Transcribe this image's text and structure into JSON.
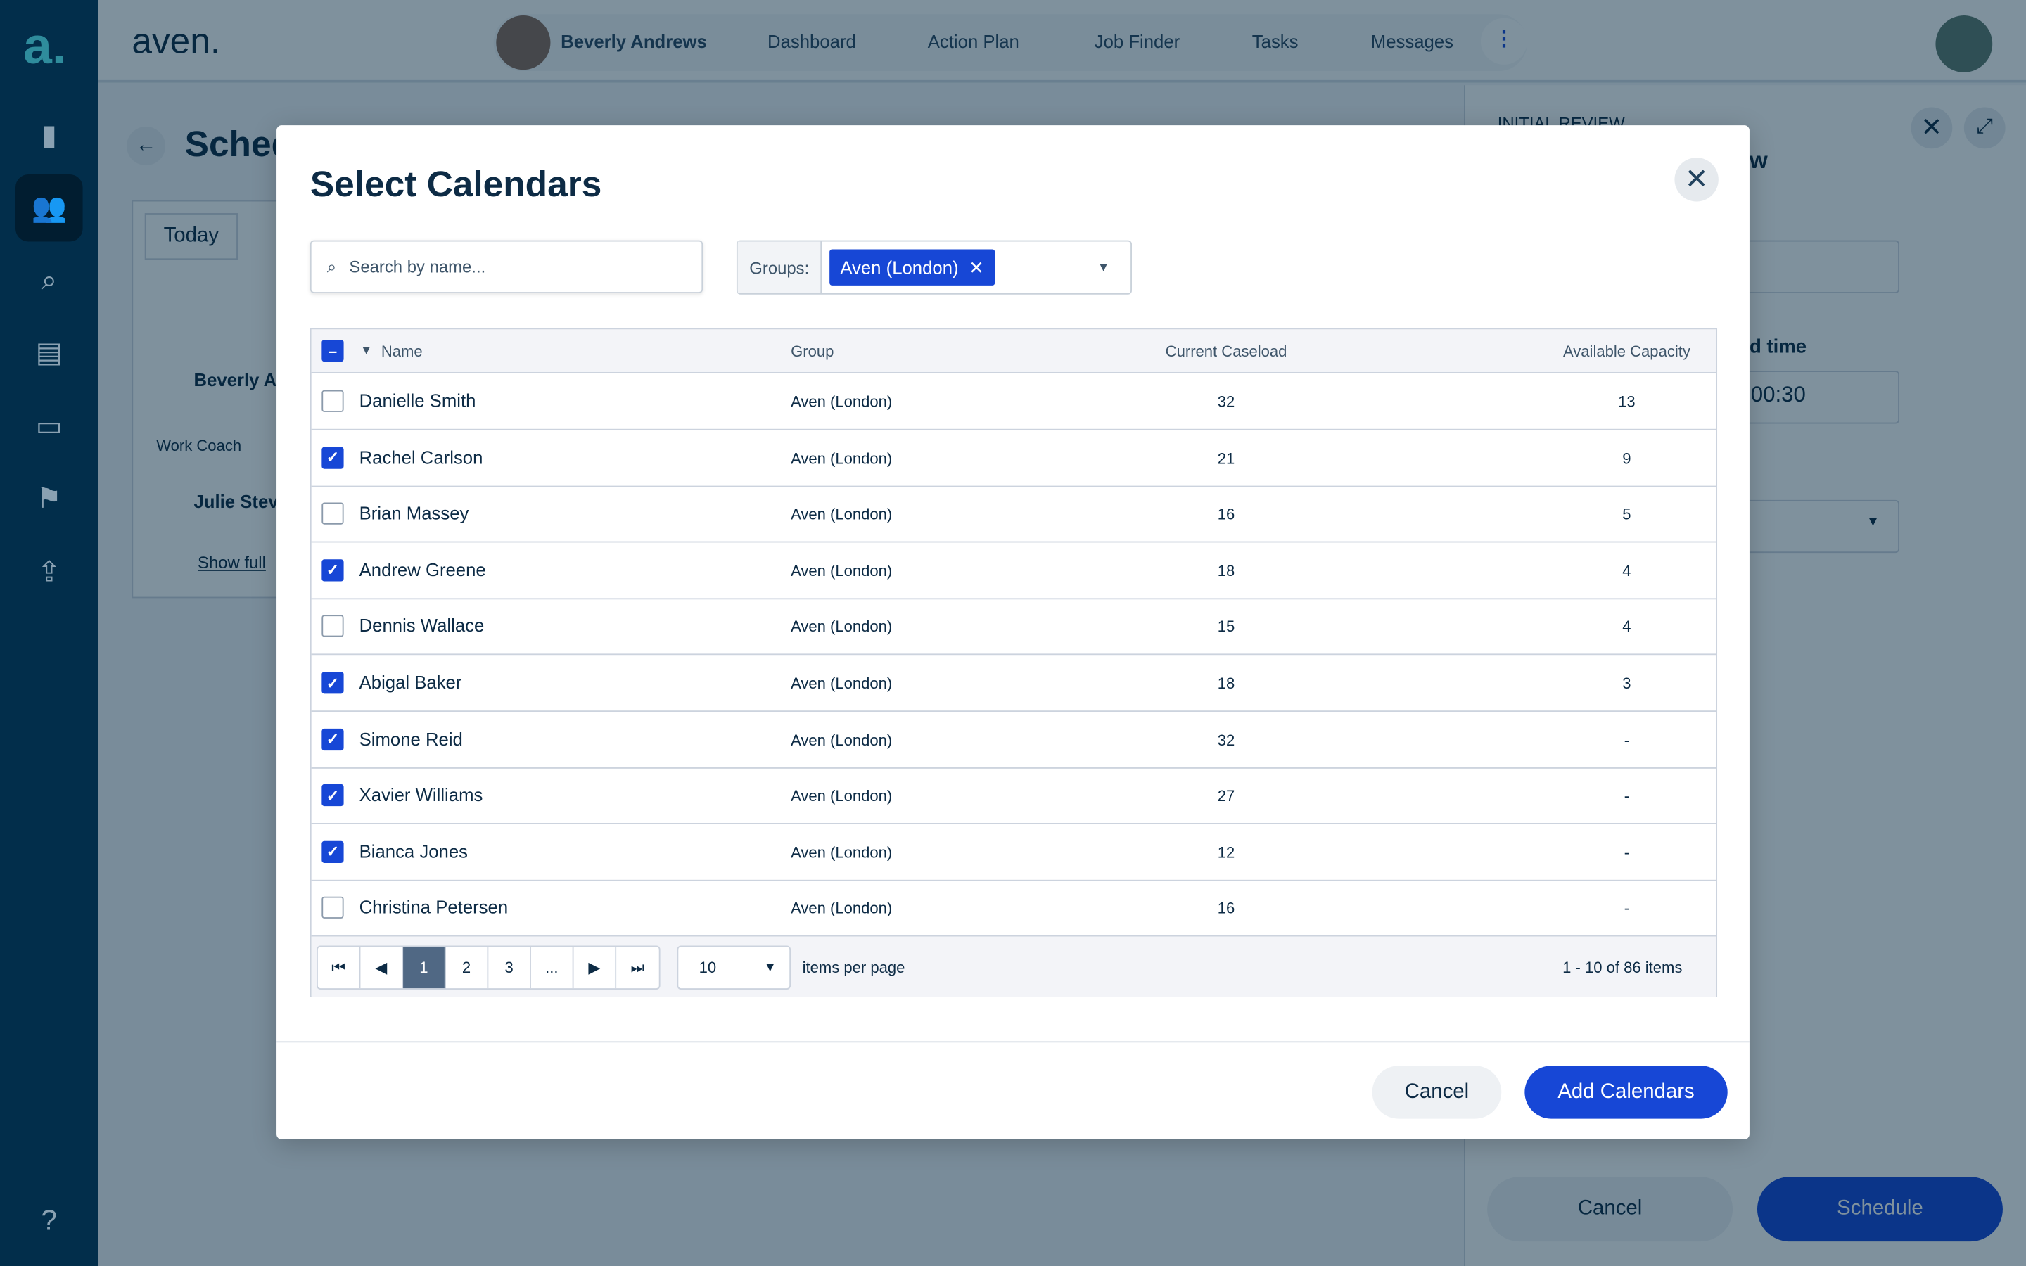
{
  "app": {
    "logo": "aven.",
    "sidebar_logo": "a."
  },
  "header": {
    "user": "Beverly Andrews",
    "nav": [
      "Dashboard",
      "Action Plan",
      "Job Finder",
      "Tasks",
      "Messages"
    ]
  },
  "background": {
    "page_title": "Schedule",
    "today": "Today",
    "person1": "Beverly A",
    "role": "Work Coach",
    "person2": "Julie Steve",
    "show_full": "Show full",
    "panel_label": "INITIAL REVIEW",
    "panel_title_fragment": "ew",
    "time_label": "d time",
    "time_value": "00:30",
    "cancel": "Cancel",
    "schedule": "Schedule"
  },
  "modal": {
    "title": "Select Calendars",
    "search_placeholder": "Search by name...",
    "groups_label": "Groups:",
    "group_chip": "Aven (London)",
    "columns": [
      "Name",
      "Group",
      "Current Caseload",
      "Available Capacity"
    ],
    "rows": [
      {
        "name": "Danielle Smith",
        "group": "Aven (London)",
        "caseload": "32",
        "capacity": "13",
        "checked": false
      },
      {
        "name": "Rachel Carlson",
        "group": "Aven (London)",
        "caseload": "21",
        "capacity": "9",
        "checked": true
      },
      {
        "name": "Brian Massey",
        "group": "Aven (London)",
        "caseload": "16",
        "capacity": "5",
        "checked": false
      },
      {
        "name": "Andrew Greene",
        "group": "Aven (London)",
        "caseload": "18",
        "capacity": "4",
        "checked": true
      },
      {
        "name": "Dennis Wallace",
        "group": "Aven (London)",
        "caseload": "15",
        "capacity": "4",
        "checked": false
      },
      {
        "name": "Abigal Baker",
        "group": "Aven (London)",
        "caseload": "18",
        "capacity": "3",
        "checked": true
      },
      {
        "name": "Simone Reid",
        "group": "Aven (London)",
        "caseload": "32",
        "capacity": "-",
        "checked": true
      },
      {
        "name": "Xavier Williams",
        "group": "Aven (London)",
        "caseload": "27",
        "capacity": "-",
        "checked": true
      },
      {
        "name": "Bianca Jones",
        "group": "Aven (London)",
        "caseload": "12",
        "capacity": "-",
        "checked": true
      },
      {
        "name": "Christina Petersen",
        "group": "Aven (London)",
        "caseload": "16",
        "capacity": "-",
        "checked": false
      }
    ],
    "pager": {
      "pages": [
        "1",
        "2",
        "3",
        "..."
      ],
      "current": "1",
      "per_page": "10",
      "per_page_label": "items per page",
      "summary": "1 - 10 of 86 items"
    },
    "cancel": "Cancel",
    "add": "Add Calendars"
  },
  "colors": {
    "accent": "#1747d6",
    "sidebar": "#04436f"
  }
}
